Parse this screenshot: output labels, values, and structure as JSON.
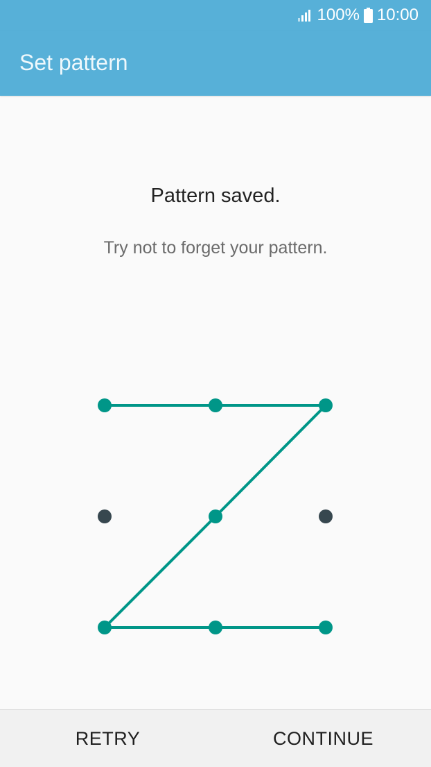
{
  "status_bar": {
    "battery": "100%",
    "time": "10:00",
    "icons": [
      "signal-icon",
      "battery-icon"
    ]
  },
  "app_bar": {
    "title": "Set pattern"
  },
  "message": {
    "heading": "Pattern saved.",
    "subtext": "Try not to forget your pattern."
  },
  "pattern": {
    "grid": "3x3",
    "selected_sequence": [
      1,
      2,
      3,
      5,
      7,
      8,
      9
    ],
    "unselected_dots": [
      4,
      6
    ]
  },
  "bottom_bar": {
    "retry_label": "RETRY",
    "continue_label": "CONTINUE"
  },
  "colors": {
    "app_bar": "#57b0d8",
    "pattern_line": "#009688",
    "dot_inactive": "#37474f",
    "background": "#fafafa"
  }
}
